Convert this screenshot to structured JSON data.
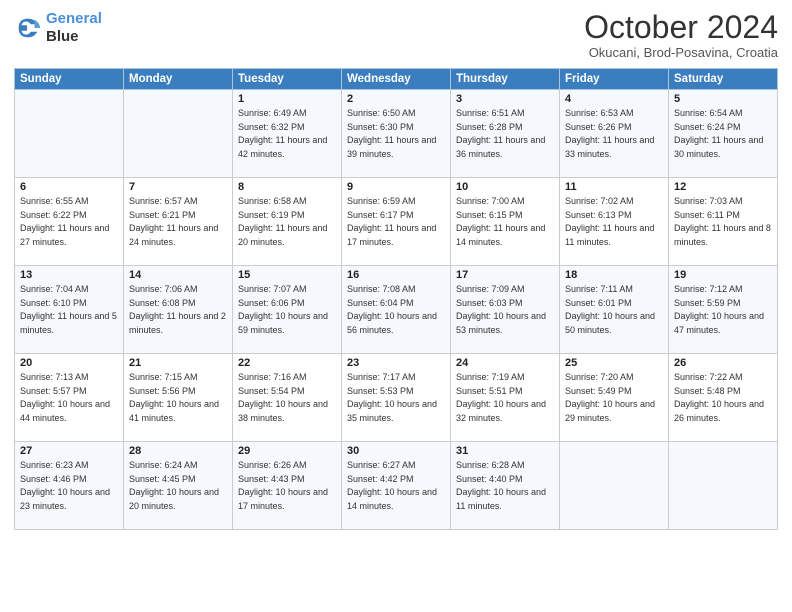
{
  "header": {
    "logo_line1": "General",
    "logo_line2": "Blue",
    "month": "October 2024",
    "location": "Okucani, Brod-Posavina, Croatia"
  },
  "days_of_week": [
    "Sunday",
    "Monday",
    "Tuesday",
    "Wednesday",
    "Thursday",
    "Friday",
    "Saturday"
  ],
  "weeks": [
    [
      {
        "num": "",
        "info": ""
      },
      {
        "num": "",
        "info": ""
      },
      {
        "num": "1",
        "info": "Sunrise: 6:49 AM\nSunset: 6:32 PM\nDaylight: 11 hours and 42 minutes."
      },
      {
        "num": "2",
        "info": "Sunrise: 6:50 AM\nSunset: 6:30 PM\nDaylight: 11 hours and 39 minutes."
      },
      {
        "num": "3",
        "info": "Sunrise: 6:51 AM\nSunset: 6:28 PM\nDaylight: 11 hours and 36 minutes."
      },
      {
        "num": "4",
        "info": "Sunrise: 6:53 AM\nSunset: 6:26 PM\nDaylight: 11 hours and 33 minutes."
      },
      {
        "num": "5",
        "info": "Sunrise: 6:54 AM\nSunset: 6:24 PM\nDaylight: 11 hours and 30 minutes."
      }
    ],
    [
      {
        "num": "6",
        "info": "Sunrise: 6:55 AM\nSunset: 6:22 PM\nDaylight: 11 hours and 27 minutes."
      },
      {
        "num": "7",
        "info": "Sunrise: 6:57 AM\nSunset: 6:21 PM\nDaylight: 11 hours and 24 minutes."
      },
      {
        "num": "8",
        "info": "Sunrise: 6:58 AM\nSunset: 6:19 PM\nDaylight: 11 hours and 20 minutes."
      },
      {
        "num": "9",
        "info": "Sunrise: 6:59 AM\nSunset: 6:17 PM\nDaylight: 11 hours and 17 minutes."
      },
      {
        "num": "10",
        "info": "Sunrise: 7:00 AM\nSunset: 6:15 PM\nDaylight: 11 hours and 14 minutes."
      },
      {
        "num": "11",
        "info": "Sunrise: 7:02 AM\nSunset: 6:13 PM\nDaylight: 11 hours and 11 minutes."
      },
      {
        "num": "12",
        "info": "Sunrise: 7:03 AM\nSunset: 6:11 PM\nDaylight: 11 hours and 8 minutes."
      }
    ],
    [
      {
        "num": "13",
        "info": "Sunrise: 7:04 AM\nSunset: 6:10 PM\nDaylight: 11 hours and 5 minutes."
      },
      {
        "num": "14",
        "info": "Sunrise: 7:06 AM\nSunset: 6:08 PM\nDaylight: 11 hours and 2 minutes."
      },
      {
        "num": "15",
        "info": "Sunrise: 7:07 AM\nSunset: 6:06 PM\nDaylight: 10 hours and 59 minutes."
      },
      {
        "num": "16",
        "info": "Sunrise: 7:08 AM\nSunset: 6:04 PM\nDaylight: 10 hours and 56 minutes."
      },
      {
        "num": "17",
        "info": "Sunrise: 7:09 AM\nSunset: 6:03 PM\nDaylight: 10 hours and 53 minutes."
      },
      {
        "num": "18",
        "info": "Sunrise: 7:11 AM\nSunset: 6:01 PM\nDaylight: 10 hours and 50 minutes."
      },
      {
        "num": "19",
        "info": "Sunrise: 7:12 AM\nSunset: 5:59 PM\nDaylight: 10 hours and 47 minutes."
      }
    ],
    [
      {
        "num": "20",
        "info": "Sunrise: 7:13 AM\nSunset: 5:57 PM\nDaylight: 10 hours and 44 minutes."
      },
      {
        "num": "21",
        "info": "Sunrise: 7:15 AM\nSunset: 5:56 PM\nDaylight: 10 hours and 41 minutes."
      },
      {
        "num": "22",
        "info": "Sunrise: 7:16 AM\nSunset: 5:54 PM\nDaylight: 10 hours and 38 minutes."
      },
      {
        "num": "23",
        "info": "Sunrise: 7:17 AM\nSunset: 5:53 PM\nDaylight: 10 hours and 35 minutes."
      },
      {
        "num": "24",
        "info": "Sunrise: 7:19 AM\nSunset: 5:51 PM\nDaylight: 10 hours and 32 minutes."
      },
      {
        "num": "25",
        "info": "Sunrise: 7:20 AM\nSunset: 5:49 PM\nDaylight: 10 hours and 29 minutes."
      },
      {
        "num": "26",
        "info": "Sunrise: 7:22 AM\nSunset: 5:48 PM\nDaylight: 10 hours and 26 minutes."
      }
    ],
    [
      {
        "num": "27",
        "info": "Sunrise: 6:23 AM\nSunset: 4:46 PM\nDaylight: 10 hours and 23 minutes."
      },
      {
        "num": "28",
        "info": "Sunrise: 6:24 AM\nSunset: 4:45 PM\nDaylight: 10 hours and 20 minutes."
      },
      {
        "num": "29",
        "info": "Sunrise: 6:26 AM\nSunset: 4:43 PM\nDaylight: 10 hours and 17 minutes."
      },
      {
        "num": "30",
        "info": "Sunrise: 6:27 AM\nSunset: 4:42 PM\nDaylight: 10 hours and 14 minutes."
      },
      {
        "num": "31",
        "info": "Sunrise: 6:28 AM\nSunset: 4:40 PM\nDaylight: 10 hours and 11 minutes."
      },
      {
        "num": "",
        "info": ""
      },
      {
        "num": "",
        "info": ""
      }
    ]
  ]
}
